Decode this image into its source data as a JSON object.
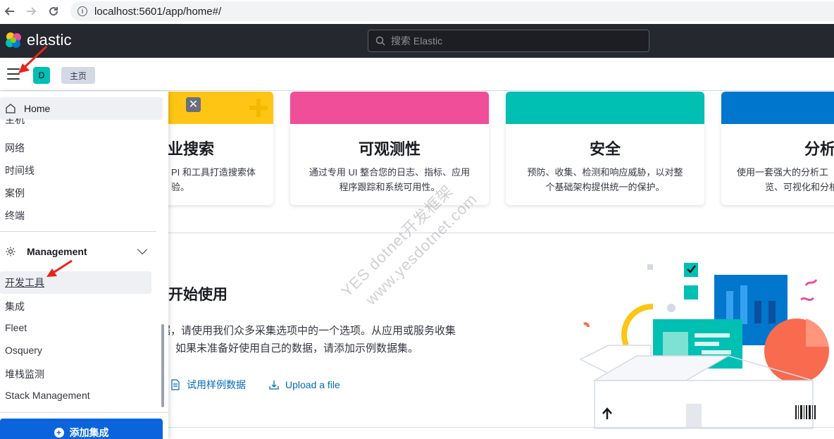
{
  "browser": {
    "url": "localhost:5601/app/home#/"
  },
  "header": {
    "logo_text": "elastic",
    "search_placeholder": "搜索 Elastic"
  },
  "subheader": {
    "space_initial": "D",
    "breadcrumb": "主页"
  },
  "sidebar": {
    "home_label": "Home",
    "partial_item": "主机",
    "items": [
      "网络",
      "时间线",
      "案例",
      "终端"
    ],
    "management": {
      "label": "Management",
      "items": [
        "开发工具",
        "集成",
        "Fleet",
        "Osquery",
        "堆栈监测",
        "Stack Management"
      ]
    },
    "add_integrations": "添加集成"
  },
  "solutions": [
    {
      "title": "业搜索",
      "desc_line1": "PI 和工具打造搜索体",
      "desc_line2": "验。",
      "color": "#fec514"
    },
    {
      "title": "可观测性",
      "desc_line1": "通过专用 UI 整合您的日志、指标、应用",
      "desc_line2": "程序跟踪和系统可用性。",
      "color": "#f04e98"
    },
    {
      "title": "安全",
      "desc_line1": "预防、收集、检测和响应威胁，以对整",
      "desc_line2": "个基础架构提供统一的保护。",
      "color": "#00bfb3"
    },
    {
      "title": "分析",
      "desc_line1": "使用一套强大的分析工",
      "desc_line2": "览、可视化和分析",
      "color": "#0077cc"
    }
  ],
  "get_started": {
    "title": "开始使用",
    "desc_line1": "据，请使用我们众多采集选项中的一个选项。从应用或服务收集",
    "desc_line2": "如果未准备好使用自己的数据，请添加示例数据集。",
    "link_sample": "试用样例数据",
    "link_upload": "Upload a file"
  },
  "watermark": {
    "line1": "YES dotnet开发框架",
    "line2": "www.yesdotnet.com"
  },
  "colors": {
    "header_bg": "#25282f",
    "accent_blue": "#0b64dd",
    "link_blue": "#006bb8"
  }
}
